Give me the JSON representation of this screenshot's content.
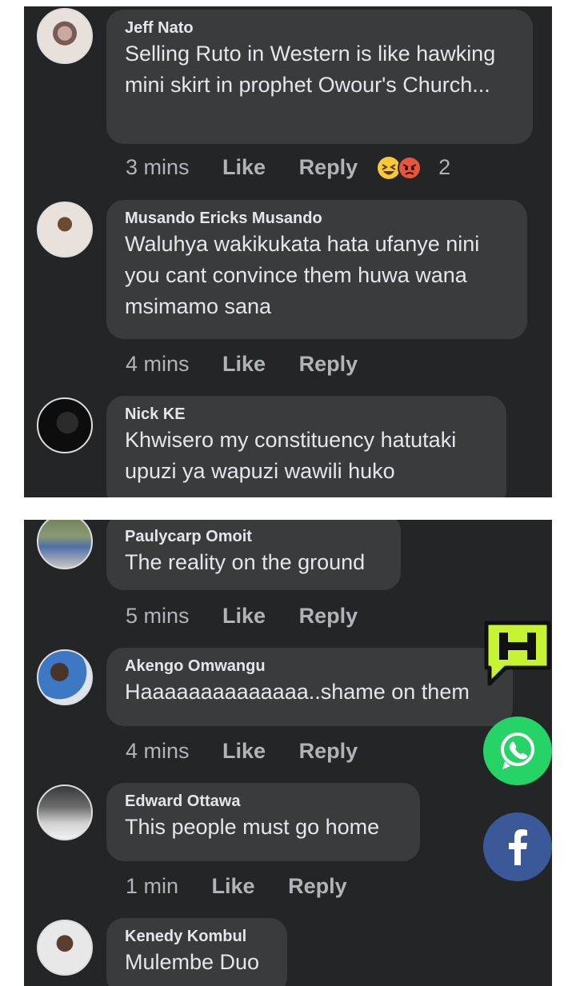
{
  "comments_top": [
    {
      "name": "Jeff Nato",
      "text": "Selling Ruto in Western is like hawking mini skirt in prophet Owour's Church...",
      "time": "3 mins",
      "like": "Like",
      "reply": "Reply",
      "reaction_count": "2",
      "reactions": [
        "laughing-emoji",
        "angry-emoji"
      ]
    },
    {
      "name": "Musando Ericks Musando",
      "text": "Waluhya wakikukata hata ufanye nini you cant convince them huwa wana msimamo sana",
      "time": "4 mins",
      "like": "Like",
      "reply": "Reply"
    },
    {
      "name": "Nick KE",
      "text": "Khwisero my constituency hatutaki upuzi ya wapuzi wawili huko"
    }
  ],
  "comments_bottom": [
    {
      "name": "Paulycarp Omoit",
      "text": "The reality on the ground",
      "time": "5 mins",
      "like": "Like",
      "reply": "Reply"
    },
    {
      "name": "Akengo Omwangu",
      "text": "Haaaaaaaaaaaaaa..shame on them",
      "time": "4 mins",
      "like": "Like",
      "reply": "Reply"
    },
    {
      "name": "Edward Ottawa",
      "text": "This people must go home",
      "time": "1 min",
      "like": "Like",
      "reply": "Reply"
    },
    {
      "name": "Kenedy Kombul",
      "text": "Mulembe Duo"
    }
  ],
  "floating_buttons": [
    "h-logo-icon",
    "whatsapp-icon",
    "facebook-icon"
  ],
  "colors": {
    "background": "#242526",
    "bubble": "#3a3b3c",
    "text": "#e4e6eb",
    "meta": "#b0b3b8",
    "whatsapp": "#25d366",
    "facebook": "#3b5998",
    "h_logo": "#c6f432"
  }
}
